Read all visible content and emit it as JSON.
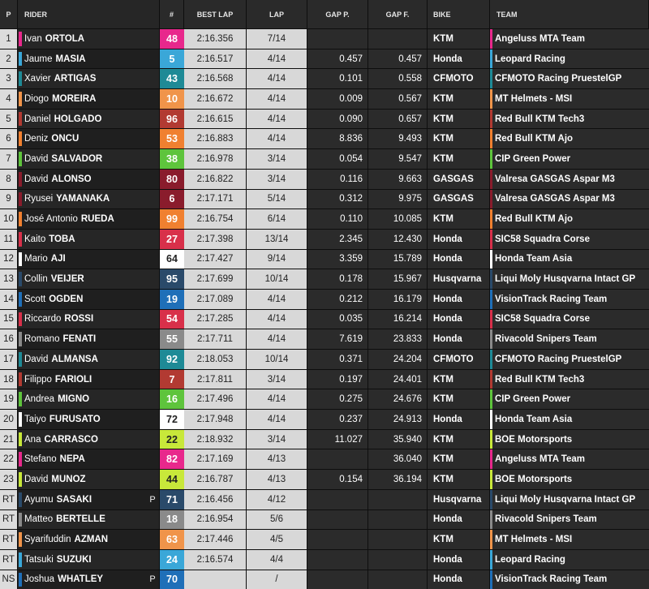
{
  "headers": {
    "pos": "P",
    "rider": "RIDER",
    "num": "#",
    "best": "BEST LAP",
    "lap": "LAP",
    "gap_p": "GAP P.",
    "gap_f": "GAP F.",
    "bike": "BIKE",
    "team": "TEAM"
  },
  "rows": [
    {
      "pos": "1",
      "first": "Ivan",
      "last": "ORTOLÁ",
      "flag": "",
      "num": "48",
      "num_color": "#e8288c",
      "num_text": "#ffffff",
      "best": "2:16.356",
      "lap": "7/14",
      "gap_p": "",
      "gap_f": "",
      "bike": "KTM",
      "team": "Angeluss MTA Team",
      "team_color": "#e8288c"
    },
    {
      "pos": "2",
      "first": "Jaume",
      "last": "MASIA",
      "flag": "",
      "num": "5",
      "num_color": "#3aa7d8",
      "num_text": "#ffffff",
      "best": "2:16.517",
      "lap": "4/14",
      "gap_p": "0.457",
      "gap_f": "0.457",
      "bike": "Honda",
      "team": "Leopard Racing",
      "team_color": "#3aa7d8"
    },
    {
      "pos": "3",
      "first": "Xavier",
      "last": "ARTIGAS",
      "flag": "",
      "num": "43",
      "num_color": "#1e8a96",
      "num_text": "#ffffff",
      "best": "2:16.568",
      "lap": "4/14",
      "gap_p": "0.101",
      "gap_f": "0.558",
      "bike": "CFMOTO",
      "team": "CFMOTO Racing PruestelGP",
      "team_color": "#1e8a96"
    },
    {
      "pos": "4",
      "first": "Diogo",
      "last": "MOREIRA",
      "flag": "",
      "num": "10",
      "num_color": "#f0944a",
      "num_text": "#ffffff",
      "best": "2:16.672",
      "lap": "4/14",
      "gap_p": "0.009",
      "gap_f": "0.567",
      "bike": "KTM",
      "team": "MT Helmets - MSI",
      "team_color": "#f0944a"
    },
    {
      "pos": "5",
      "first": "Daniel",
      "last": "HOLGADO",
      "flag": "",
      "num": "96",
      "num_color": "#b23a32",
      "num_text": "#ffffff",
      "best": "2:16.615",
      "lap": "4/14",
      "gap_p": "0.090",
      "gap_f": "0.657",
      "bike": "KTM",
      "team": "Red Bull KTM Tech3",
      "team_color": "#b23a32"
    },
    {
      "pos": "6",
      "first": "Deniz",
      "last": "ÖNCÜ",
      "flag": "",
      "num": "53",
      "num_color": "#f08030",
      "num_text": "#ffffff",
      "best": "2:16.883",
      "lap": "4/14",
      "gap_p": "8.836",
      "gap_f": "9.493",
      "bike": "KTM",
      "team": "Red Bull KTM Ajo",
      "team_color": "#f08030"
    },
    {
      "pos": "7",
      "first": "David",
      "last": "SALVADOR",
      "flag": "",
      "num": "38",
      "num_color": "#5ec43c",
      "num_text": "#ffffff",
      "best": "2:16.978",
      "lap": "3/14",
      "gap_p": "0.054",
      "gap_f": "9.547",
      "bike": "KTM",
      "team": "CIP Green Power",
      "team_color": "#5ec43c"
    },
    {
      "pos": "8",
      "first": "David",
      "last": "ALONSO",
      "flag": "",
      "num": "80",
      "num_color": "#8a1c2c",
      "num_text": "#ffffff",
      "best": "2:16.822",
      "lap": "3/14",
      "gap_p": "0.116",
      "gap_f": "9.663",
      "bike": "GASGAS",
      "team": "Valresa GASGAS Aspar M3",
      "team_color": "#8a1c2c"
    },
    {
      "pos": "9",
      "first": "Ryusei",
      "last": "YAMANAKA",
      "flag": "",
      "num": "6",
      "num_color": "#8a1c2c",
      "num_text": "#ffffff",
      "best": "2:17.171",
      "lap": "5/14",
      "gap_p": "0.312",
      "gap_f": "9.975",
      "bike": "GASGAS",
      "team": "Valresa GASGAS Aspar M3",
      "team_color": "#8a1c2c"
    },
    {
      "pos": "10",
      "first": "José Antonio",
      "last": "RUEDA",
      "flag": "",
      "num": "99",
      "num_color": "#f08030",
      "num_text": "#ffffff",
      "best": "2:16.754",
      "lap": "6/14",
      "gap_p": "0.110",
      "gap_f": "10.085",
      "bike": "KTM",
      "team": "Red Bull KTM Ajo",
      "team_color": "#f08030"
    },
    {
      "pos": "11",
      "first": "Kaito",
      "last": "TOBA",
      "flag": "",
      "num": "27",
      "num_color": "#d8304a",
      "num_text": "#ffffff",
      "best": "2:17.398",
      "lap": "13/14",
      "gap_p": "2.345",
      "gap_f": "12.430",
      "bike": "Honda",
      "team": "SIC58 Squadra Corse",
      "team_color": "#d8304a"
    },
    {
      "pos": "12",
      "first": "Mario",
      "last": "AJI",
      "flag": "",
      "num": "64",
      "num_color": "#ffffff",
      "num_text": "#222222",
      "best": "2:17.427",
      "lap": "9/14",
      "gap_p": "3.359",
      "gap_f": "15.789",
      "bike": "Honda",
      "team": "Honda Team Asia",
      "team_color": "#ffffff"
    },
    {
      "pos": "13",
      "first": "Collin",
      "last": "VEIJER",
      "flag": "",
      "num": "95",
      "num_color": "#2a4a6a",
      "num_text": "#ffffff",
      "best": "2:17.699",
      "lap": "10/14",
      "gap_p": "0.178",
      "gap_f": "15.967",
      "bike": "Husqvarna",
      "team": "Liqui Moly Husqvarna Intact GP",
      "team_color": "#2a4a6a"
    },
    {
      "pos": "14",
      "first": "Scott",
      "last": "OGDEN",
      "flag": "",
      "num": "19",
      "num_color": "#1f6fb8",
      "num_text": "#ffffff",
      "best": "2:17.089",
      "lap": "4/14",
      "gap_p": "0.212",
      "gap_f": "16.179",
      "bike": "Honda",
      "team": "VisionTrack Racing Team",
      "team_color": "#1f6fb8"
    },
    {
      "pos": "15",
      "first": "Riccardo",
      "last": "ROSSI",
      "flag": "",
      "num": "54",
      "num_color": "#d8304a",
      "num_text": "#ffffff",
      "best": "2:17.285",
      "lap": "4/14",
      "gap_p": "0.035",
      "gap_f": "16.214",
      "bike": "Honda",
      "team": "SIC58 Squadra Corse",
      "team_color": "#d8304a"
    },
    {
      "pos": "16",
      "first": "Romano",
      "last": "FENATI",
      "flag": "",
      "num": "55",
      "num_color": "#8a8a8a",
      "num_text": "#ffffff",
      "best": "2:17.711",
      "lap": "4/14",
      "gap_p": "7.619",
      "gap_f": "23.833",
      "bike": "Honda",
      "team": "Rivacold Snipers Team",
      "team_color": "#8a8a8a"
    },
    {
      "pos": "17",
      "first": "David",
      "last": "ALMANSA",
      "flag": "",
      "num": "92",
      "num_color": "#1e8a96",
      "num_text": "#ffffff",
      "best": "2:18.053",
      "lap": "10/14",
      "gap_p": "0.371",
      "gap_f": "24.204",
      "bike": "CFMOTO",
      "team": "CFMOTO Racing PruestelGP",
      "team_color": "#1e8a96"
    },
    {
      "pos": "18",
      "first": "Filippo",
      "last": "FARIOLI",
      "flag": "",
      "num": "7",
      "num_color": "#b23a32",
      "num_text": "#ffffff",
      "best": "2:17.811",
      "lap": "3/14",
      "gap_p": "0.197",
      "gap_f": "24.401",
      "bike": "KTM",
      "team": "Red Bull KTM Tech3",
      "team_color": "#b23a32"
    },
    {
      "pos": "19",
      "first": "Andrea",
      "last": "MIGNO",
      "flag": "",
      "num": "16",
      "num_color": "#5ec43c",
      "num_text": "#ffffff",
      "best": "2:17.496",
      "lap": "4/14",
      "gap_p": "0.275",
      "gap_f": "24.676",
      "bike": "KTM",
      "team": "CIP Green Power",
      "team_color": "#5ec43c"
    },
    {
      "pos": "20",
      "first": "Taiyo",
      "last": "FURUSATO",
      "flag": "",
      "num": "72",
      "num_color": "#ffffff",
      "num_text": "#222222",
      "best": "2:17.948",
      "lap": "4/14",
      "gap_p": "0.237",
      "gap_f": "24.913",
      "bike": "Honda",
      "team": "Honda Team Asia",
      "team_color": "#ffffff"
    },
    {
      "pos": "21",
      "first": "Ana",
      "last": "CARRASCO",
      "flag": "",
      "num": "22",
      "num_color": "#c8e83a",
      "num_text": "#222222",
      "best": "2:18.932",
      "lap": "3/14",
      "gap_p": "11.027",
      "gap_f": "35.940",
      "bike": "KTM",
      "team": "BOE Motorsports",
      "team_color": "#c8e83a"
    },
    {
      "pos": "22",
      "first": "Stefano",
      "last": "NEPA",
      "flag": "",
      "num": "82",
      "num_color": "#e8288c",
      "num_text": "#ffffff",
      "best": "2:17.169",
      "lap": "4/13",
      "gap_p": "",
      "gap_f": "36.040",
      "bike": "KTM",
      "team": "Angeluss MTA Team",
      "team_color": "#e8288c"
    },
    {
      "pos": "23",
      "first": "David",
      "last": "MUÑOZ",
      "flag": "",
      "num": "44",
      "num_color": "#c8e83a",
      "num_text": "#222222",
      "best": "2:16.787",
      "lap": "4/13",
      "gap_p": "0.154",
      "gap_f": "36.194",
      "bike": "KTM",
      "team": "BOE Motorsports",
      "team_color": "#c8e83a"
    },
    {
      "pos": "RT",
      "first": "Ayumu",
      "last": "SASAKI",
      "flag": "P",
      "num": "71",
      "num_color": "#2a4a6a",
      "num_text": "#ffffff",
      "best": "2:16.456",
      "lap": "4/12",
      "gap_p": "",
      "gap_f": "",
      "bike": "Husqvarna",
      "team": "Liqui Moly Husqvarna Intact GP",
      "team_color": "#2a4a6a"
    },
    {
      "pos": "RT",
      "first": "Matteo",
      "last": "BERTELLE",
      "flag": "",
      "num": "18",
      "num_color": "#8a8a8a",
      "num_text": "#ffffff",
      "best": "2:16.954",
      "lap": "5/6",
      "gap_p": "",
      "gap_f": "",
      "bike": "Honda",
      "team": "Rivacold Snipers Team",
      "team_color": "#8a8a8a"
    },
    {
      "pos": "RT",
      "first": "Syarifuddin",
      "last": "AZMAN",
      "flag": "",
      "num": "63",
      "num_color": "#f0944a",
      "num_text": "#ffffff",
      "best": "2:17.446",
      "lap": "4/5",
      "gap_p": "",
      "gap_f": "",
      "bike": "KTM",
      "team": "MT Helmets - MSI",
      "team_color": "#f0944a"
    },
    {
      "pos": "RT",
      "first": "Tatsuki",
      "last": "SUZUKI",
      "flag": "",
      "num": "24",
      "num_color": "#3aa7d8",
      "num_text": "#ffffff",
      "best": "2:16.574",
      "lap": "4/4",
      "gap_p": "",
      "gap_f": "",
      "bike": "Honda",
      "team": "Leopard Racing",
      "team_color": "#3aa7d8"
    },
    {
      "pos": "NS",
      "first": "Joshua",
      "last": "WHATLEY",
      "flag": "P",
      "num": "70",
      "num_color": "#1f6fb8",
      "num_text": "#ffffff",
      "best": "",
      "lap": "/",
      "gap_p": "",
      "gap_f": "",
      "bike": "Honda",
      "team": "VisionTrack Racing Team",
      "team_color": "#1f6fb8"
    }
  ]
}
